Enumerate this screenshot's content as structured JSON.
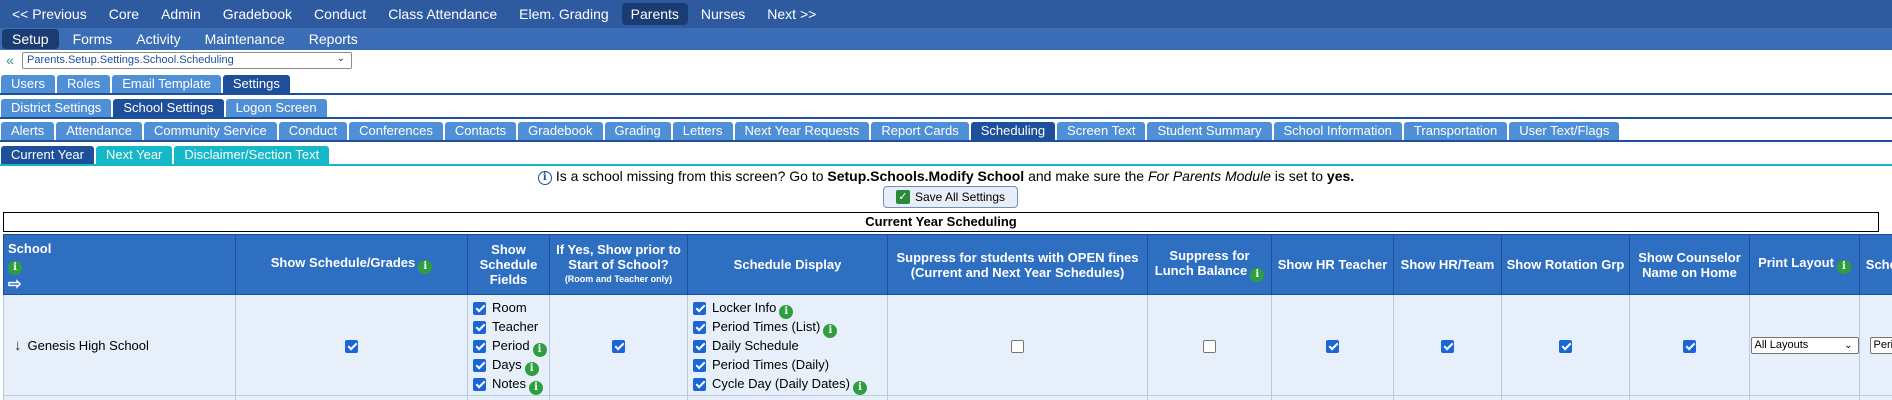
{
  "top_nav": [
    "<< Previous",
    "Core",
    "Admin",
    "Gradebook",
    "Conduct",
    "Class Attendance",
    "Elem. Grading",
    "Parents",
    "Nurses",
    "Next >>"
  ],
  "sub_nav": [
    "Setup",
    "Forms",
    "Activity",
    "Maintenance",
    "Reports"
  ],
  "breadcrumb": "Parents.Setup.Settings.School.Scheduling",
  "tabs_row1": [
    "Users",
    "Roles",
    "Email Template",
    "Settings"
  ],
  "tabs_row2": [
    "District Settings",
    "School Settings",
    "Logon Screen"
  ],
  "tabs_row3": [
    "Alerts",
    "Attendance",
    "Community Service",
    "Conduct",
    "Conferences",
    "Contacts",
    "Gradebook",
    "Grading",
    "Letters",
    "Next Year Requests",
    "Report Cards",
    "Scheduling",
    "Screen Text",
    "Student Summary",
    "School Information",
    "Transportation",
    "User Text/Flags"
  ],
  "tabs_row4": [
    "Current Year",
    "Next Year",
    "Disclaimer/Section Text"
  ],
  "notice": {
    "part1": "Is a school missing from this screen? Go to ",
    "link": "Setup.Schools.Modify School",
    "part2": " and make sure the ",
    "module": "For Parents Module",
    "part3": " is set to ",
    "value": "yes."
  },
  "save_button": "Save All Settings",
  "table_title": "Current Year Scheduling",
  "columns": {
    "school": "School",
    "show_schedule_grades": "Show Schedule/Grades",
    "show_schedule_fields": "Show Schedule Fields",
    "if_yes_show_prior": "If Yes, Show prior to Start of School?",
    "if_yes_show_prior_note": "(Room and Teacher only)",
    "schedule_display": "Schedule Display",
    "suppress_open_fines": "Suppress for students with OPEN fines (Current and Next Year Schedules)",
    "suppress_lunch": "Suppress for Lunch Balance",
    "show_hr_teacher": "Show HR Teacher",
    "show_hr_team": "Show HR/Team",
    "show_rotation_grp": "Show Rotation Grp",
    "show_counselor": "Show Counselor Name on Home",
    "print_layout": "Print Layout",
    "schedule_sort": "Schedule Sort"
  },
  "row": {
    "school": "Genesis High School",
    "schedule_fields": [
      "Room",
      "Teacher",
      "Period",
      "Days",
      "Notes"
    ],
    "schedule_display": [
      "Locker Info",
      "Period Times (List)",
      "Daily Schedule",
      "Period Times (Daily)",
      "Cycle Day (Daily Dates)"
    ],
    "print_layout": "All Layouts",
    "schedule_sort": "Period"
  },
  "colors": {
    "nav": "#2e5ba0",
    "header": "#2e6fc1",
    "cell": "#e6effa",
    "info": "#2f9e3f"
  }
}
